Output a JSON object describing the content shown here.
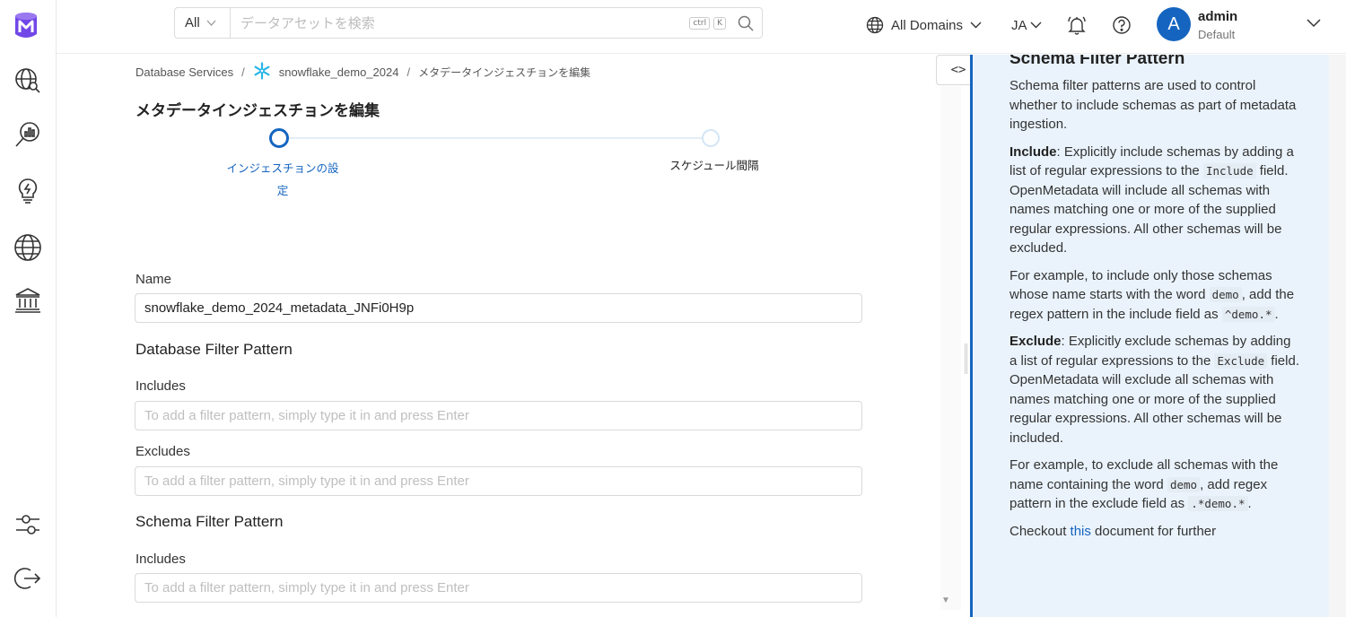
{
  "search": {
    "scope": "All",
    "placeholder": "データアセットを検索",
    "shortcut_mod": "ctrl",
    "shortcut_key": "K"
  },
  "header": {
    "domains_label": "All Domains",
    "language": "JA",
    "user": {
      "initial": "A",
      "name": "admin",
      "role": "Default"
    }
  },
  "breadcrumb": {
    "root": "Database Services",
    "service": "snowflake_demo_2024",
    "current": "メタデータインジェスチョンを編集"
  },
  "page_title": "メタデータインジェスチョンを編集",
  "steps": [
    {
      "label": "インジェスチョンの設定",
      "active": true
    },
    {
      "label": "スケジュール間隔",
      "active": false
    }
  ],
  "form": {
    "name_label": "Name",
    "name_value": "snowflake_demo_2024_metadata_JNFi0H9p",
    "database_filter_title": "Database Filter Pattern",
    "db_includes_label": "Includes",
    "db_excludes_label": "Excludes",
    "schema_filter_title": "Schema Filter Pattern",
    "schema_includes_label": "Includes",
    "filter_placeholder": "To add a filter pattern, simply type it in and press Enter"
  },
  "splitter": {
    "toggle_label": "<>"
  },
  "help_panel": {
    "heading": "Schema Filter Pattern",
    "intro": "Schema filter patterns are used to control whether to include schemas as part of metadata ingestion.",
    "include_term": "Include",
    "include_text_a": ": Explicitly include schemas by adding a list of regular expressions to the ",
    "include_code": "Include",
    "include_text_b": " field. OpenMetadata will include all schemas with names matching one or more of the supplied regular expressions. All other schemas will be excluded.",
    "include_example_a": "For example, to include only those schemas whose name starts with the word ",
    "include_example_code1": "demo",
    "include_example_b": ", add the regex pattern in the include field as ",
    "include_example_code2": "^demo.*",
    "include_example_c": ".",
    "exclude_term": "Exclude",
    "exclude_text_a": ": Explicitly exclude schemas by adding a list of regular expressions to the ",
    "exclude_code": "Exclude",
    "exclude_text_b": " field. OpenMetadata will exclude all schemas with names matching one or more of the supplied regular expressions. All other schemas will be included.",
    "exclude_example_a": "For example, to exclude all schemas with the name containing the word ",
    "exclude_example_code1": "demo",
    "exclude_example_b": ", add regex pattern in the exclude field as ",
    "exclude_example_code2": ".*demo.*",
    "exclude_example_c": ".",
    "checkout_a": "Checkout ",
    "checkout_link": "this",
    "checkout_b": " document for further"
  },
  "colors": {
    "accent": "#1565c0",
    "panel_bg": "#eaf3fc",
    "logo": "#7147e8"
  },
  "icons": [
    "logo-icon",
    "explore-icon",
    "data-quality-icon",
    "insights-icon",
    "domains-icon",
    "governance-icon",
    "settings-icon",
    "logout-icon",
    "globe-icon",
    "bell-icon",
    "help-icon",
    "search-icon",
    "snowflake-icon"
  ]
}
